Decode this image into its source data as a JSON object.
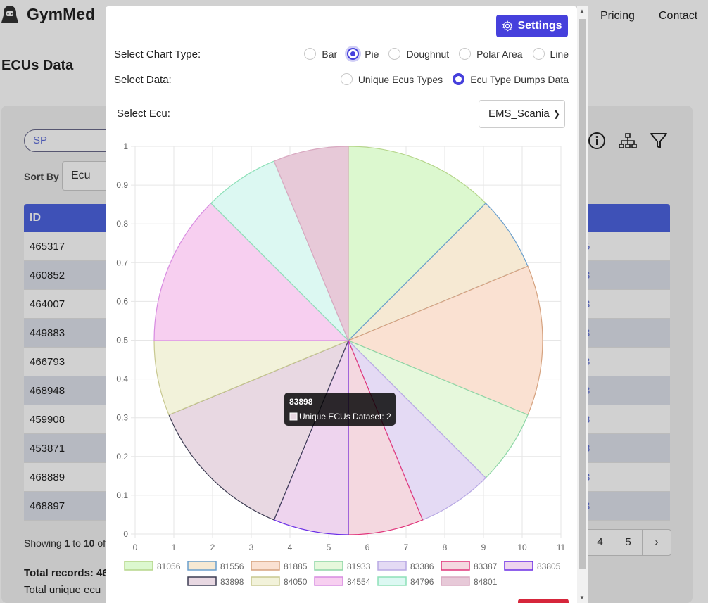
{
  "brand": {
    "name": "GymMed"
  },
  "nav": {
    "pricing": "Pricing",
    "contact": "Contact"
  },
  "page": {
    "title": "ECUs Data"
  },
  "search": {
    "value": "SP"
  },
  "sort": {
    "label": "Sort By",
    "value": "Ecu"
  },
  "table": {
    "header_id": "ID",
    "rows": [
      {
        "id": "465317",
        "right": "5"
      },
      {
        "id": "460852",
        "right": "3"
      },
      {
        "id": "464007",
        "right": "3"
      },
      {
        "id": "449883",
        "right": "3"
      },
      {
        "id": "466793",
        "right": "3"
      },
      {
        "id": "468948",
        "right": "3"
      },
      {
        "id": "459908",
        "right": "3"
      },
      {
        "id": "453871",
        "right": "3"
      },
      {
        "id": "468889",
        "right": "3"
      },
      {
        "id": "468897",
        "right": "3"
      }
    ]
  },
  "showing": {
    "prefix": "Showing ",
    "from": "1",
    "to_word": " to ",
    "to": "10",
    "suffix": " of"
  },
  "totals": {
    "records": "Total records: 46",
    "unique": "Total unique ecu"
  },
  "pager": {
    "p4": "4",
    "p5": "5",
    "next": "›"
  },
  "modal": {
    "settings_label": "Settings",
    "chart_type_label": "Select Chart Type:",
    "chart_types": [
      "Bar",
      "Pie",
      "Doughnut",
      "Polar Area",
      "Line"
    ],
    "chart_type_selected": "Pie",
    "data_label": "Select Data:",
    "data_options": [
      "Unique Ecus Types",
      "Ecu Type Dumps Data"
    ],
    "data_selected": "Ecu Type Dumps Data",
    "ecu_label": "Select Ecu:",
    "ecu_value": "EMS_Scania"
  },
  "chart_data": {
    "type": "pie",
    "x_ticks": [
      "0",
      "1",
      "2",
      "3",
      "4",
      "5",
      "6",
      "7",
      "8",
      "9",
      "10",
      "11"
    ],
    "y_ticks": [
      "0",
      "0.1",
      "0.2",
      "0.3",
      "0.4",
      "0.5",
      "0.6",
      "0.7",
      "0.8",
      "0.9",
      "1"
    ],
    "dataset_label": "Unique ECUs Dataset",
    "slices": [
      {
        "label": "81056",
        "value": 2,
        "fill": "#dcf8cf",
        "stroke": "#b5d58a"
      },
      {
        "label": "81556",
        "value": 1,
        "fill": "#f6e9d3",
        "stroke": "#6a9fcd"
      },
      {
        "label": "81885",
        "value": 2,
        "fill": "#fae1d2",
        "stroke": "#d5a27f"
      },
      {
        "label": "81933",
        "value": 1,
        "fill": "#e6f8dc",
        "stroke": "#8ed6a7"
      },
      {
        "label": "83386",
        "value": 1,
        "fill": "#e4daf4",
        "stroke": "#b8a9e4"
      },
      {
        "label": "83387",
        "value": 1,
        "fill": "#f4d8e0",
        "stroke": "#e0357b"
      },
      {
        "label": "83805",
        "value": 1,
        "fill": "#eed4ee",
        "stroke": "#6b2fe6"
      },
      {
        "label": "83898",
        "value": 2,
        "fill": "#e8d8e2",
        "stroke": "#3c3c52"
      },
      {
        "label": "84050",
        "value": 1,
        "fill": "#f2f2da",
        "stroke": "#c8c890"
      },
      {
        "label": "84554",
        "value": 2,
        "fill": "#f7cff0",
        "stroke": "#d78be0"
      },
      {
        "label": "84796",
        "value": 1,
        "fill": "#dcf8f2",
        "stroke": "#8de0b8"
      },
      {
        "label": "84801",
        "value": 1,
        "fill": "#e7c9d8",
        "stroke": "#d8a8c0"
      }
    ],
    "tooltip": {
      "title": "83898",
      "text": "Unique ECUs Dataset: 2"
    }
  },
  "colors": {
    "accent": "#4640dc",
    "table_header": "#4c63e0"
  }
}
